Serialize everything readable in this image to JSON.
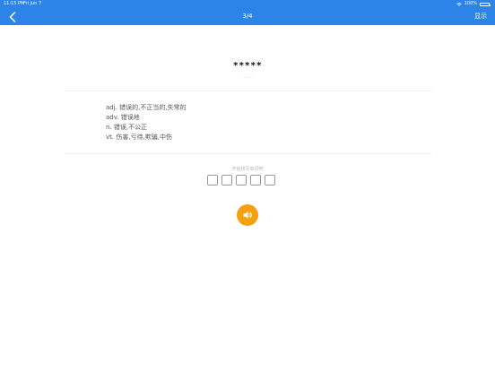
{
  "status_bar": {
    "time": "11:15 PM",
    "date": "Fri Jun 7",
    "battery": "100%"
  },
  "nav": {
    "progress": "3/4",
    "show_label": "显示"
  },
  "word": {
    "masked": "*****",
    "phonetic": "········"
  },
  "meanings": [
    "adj. 错误的,不正当的,失常的",
    "adv. 错误地",
    "n. 错误,不公正",
    "vt. 伤害,亏待,欺骗,中伤"
  ],
  "spelling": {
    "hint": "开始拼写单词吧",
    "letter_count": 5
  },
  "colors": {
    "header": "#2c84e8",
    "speaker_button": "#f5a00f"
  },
  "icons": {
    "back": "chevron-left-icon",
    "speaker": "speaker-icon",
    "wifi": "wifi-icon",
    "battery": "battery-icon"
  }
}
